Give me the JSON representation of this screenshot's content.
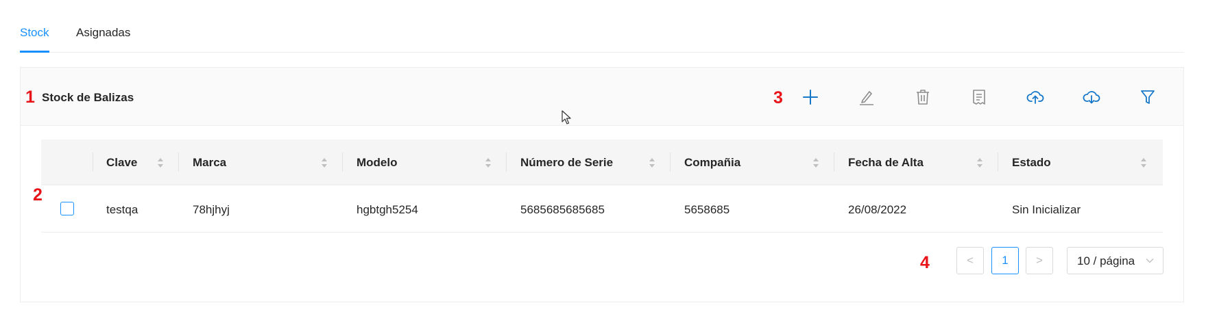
{
  "tabs": [
    {
      "label": "Stock",
      "active": true
    },
    {
      "label": "Asignadas",
      "active": false
    }
  ],
  "card": {
    "title": "Stock de Balizas"
  },
  "annotations": {
    "a1": "1",
    "a2": "2",
    "a3": "3",
    "a4": "4"
  },
  "toolbar": {
    "icons": [
      "plus-icon",
      "edit-icon",
      "delete-icon",
      "report-icon",
      "cloud-upload-icon",
      "cloud-download-icon",
      "filter-icon"
    ],
    "accent_color": "#1677c9",
    "muted_color": "#8c8c8c"
  },
  "table": {
    "columns": [
      "Clave",
      "Marca",
      "Modelo",
      "Número de Serie",
      "Compañia",
      "Fecha de Alta",
      "Estado"
    ],
    "rows": [
      {
        "clave": "testqa",
        "marca": "78hjhyj",
        "modelo": "hgbtgh5254",
        "numero_serie": "5685685685685",
        "compania": "5658685",
        "fecha_alta": "26/08/2022",
        "estado": "Sin Inicializar"
      }
    ]
  },
  "pagination": {
    "prev": "<",
    "current": "1",
    "next": ">",
    "page_size": "10 / página"
  }
}
